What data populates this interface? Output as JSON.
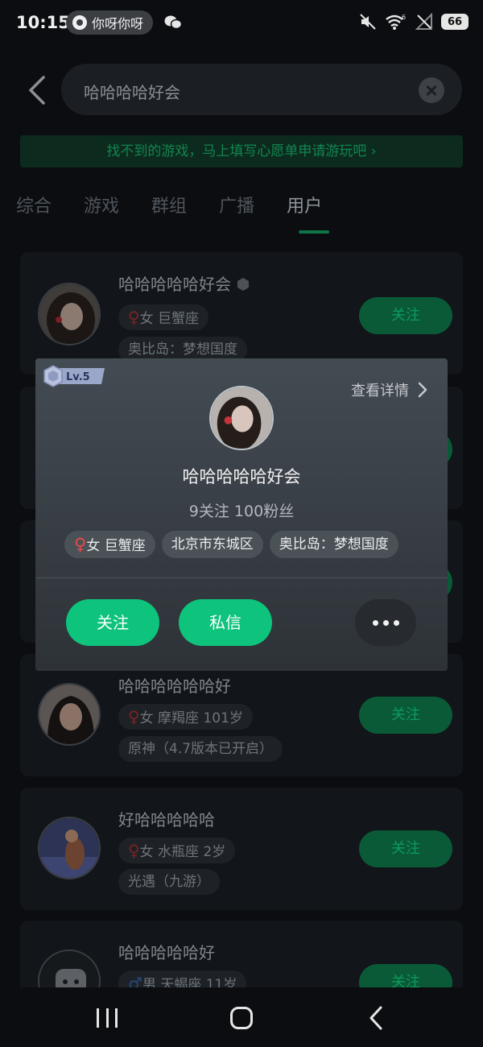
{
  "status_bar": {
    "time": "10:15",
    "notification_text": "你呀你呀",
    "battery": "66",
    "icons": [
      "notification-app-icon",
      "wechat-icon",
      "mute-icon",
      "wifi-icon",
      "signal-icon",
      "battery-icon"
    ]
  },
  "search": {
    "query": "哈哈哈哈好会"
  },
  "banner": {
    "text": "找不到的游戏，马上填写心愿单申请游玩吧 ›"
  },
  "tabs": [
    {
      "label": "综合",
      "active": false
    },
    {
      "label": "游戏",
      "active": false
    },
    {
      "label": "群组",
      "active": false
    },
    {
      "label": "广播",
      "active": false
    },
    {
      "label": "用户",
      "active": true
    }
  ],
  "results": [
    {
      "name": "哈哈哈哈哈好会",
      "gender_symbol": "♀",
      "info": "女 巨蟹座",
      "game": "奥比岛：梦想国度",
      "follow": "关注"
    },
    {
      "name": "哈哈哈哈哈哈好",
      "gender_symbol": "♀",
      "info": "女 摩羯座 101岁",
      "game": "原神（4.7版本已开启）",
      "follow": "关注"
    },
    {
      "name": "好哈哈哈哈哈",
      "gender_symbol": "♀",
      "info": "女 水瓶座 2岁",
      "game": "光遇（九游）",
      "follow": "关注"
    },
    {
      "name": "哈哈哈哈哈好",
      "gender_symbol": "♂",
      "info": "男 天蝎座 11岁",
      "game": "",
      "follow": "关注"
    }
  ],
  "popup": {
    "level": "Lv.5",
    "detail_link": "查看详情",
    "name": "哈哈哈哈哈好会",
    "stats": "9关注 100粉丝",
    "tags": [
      {
        "symbol": "♀",
        "text": "女 巨蟹座"
      },
      {
        "symbol": "",
        "text": "北京市东城区"
      },
      {
        "symbol": "",
        "text": "奥比岛：梦想国度"
      }
    ],
    "follow_button": "关注",
    "message_button": "私信"
  }
}
